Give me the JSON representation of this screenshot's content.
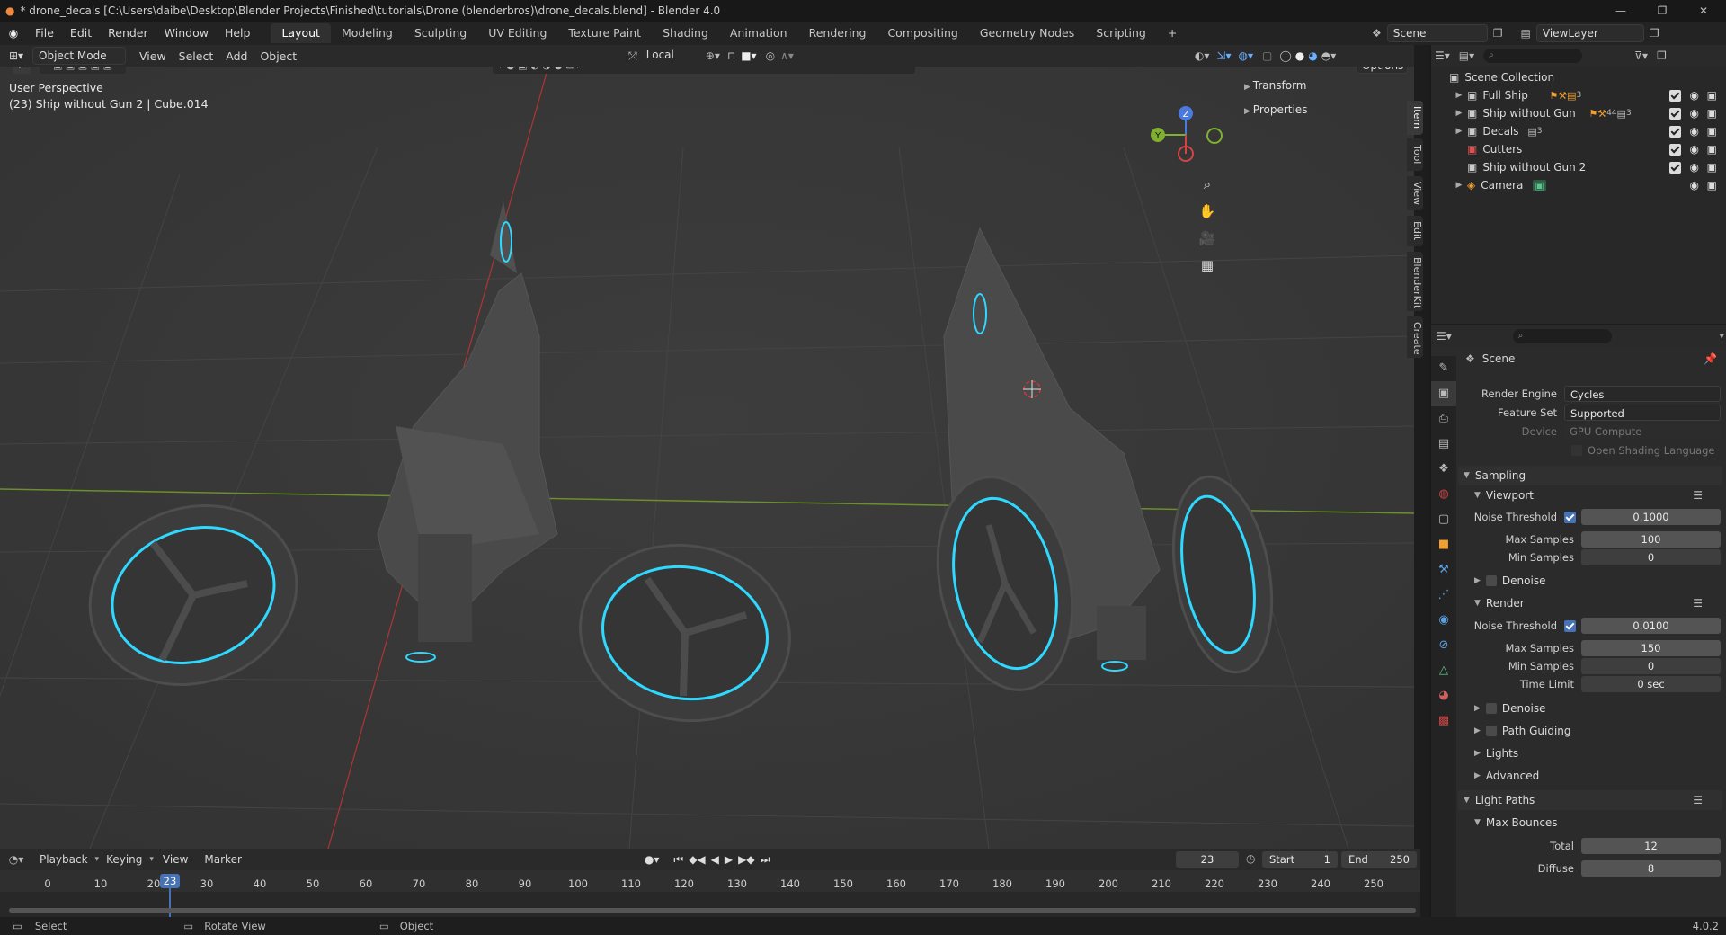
{
  "window": {
    "title": "* drone_decals [C:\\Users\\daibe\\Desktop\\Blender Projects\\Finished\\tutorials\\Drone (blenderbros)\\drone_decals.blend] - Blender 4.0"
  },
  "menu": [
    "File",
    "Edit",
    "Render",
    "Window",
    "Help"
  ],
  "workspaces": [
    "Layout",
    "Modeling",
    "Sculpting",
    "UV Editing",
    "Texture Paint",
    "Shading",
    "Animation",
    "Rendering",
    "Compositing",
    "Geometry Nodes",
    "Scripting"
  ],
  "active_workspace": "Layout",
  "scene_selector": "Scene",
  "viewlayer_selector": "ViewLayer",
  "viewport_header": {
    "mode": "Object Mode",
    "menus": [
      "View",
      "Select",
      "Add",
      "Object"
    ],
    "transform_orientation": "Local",
    "options_label": "Options"
  },
  "viewport": {
    "perspective": "User Perspective",
    "active_object": "(23) Ship without Gun 2 | Cube.014",
    "panels": [
      "Transform",
      "Properties"
    ],
    "side_tabs": [
      "Item",
      "Tool",
      "View",
      "Edit",
      "BlenderKit",
      "Create"
    ],
    "gizmo": {
      "z": "Z",
      "y": "Y"
    }
  },
  "outliner": {
    "root": "Scene Collection",
    "items": [
      {
        "name": "Full Ship",
        "badge": "3",
        "expand": true
      },
      {
        "name": "Ship without Gun",
        "badge": "3",
        "badge2": "44",
        "expand": true
      },
      {
        "name": "Decals",
        "badge": "3",
        "expand": true
      },
      {
        "name": "Cutters",
        "badge": "",
        "expand": false
      },
      {
        "name": "Ship without Gun 2",
        "badge": "",
        "expand": false
      },
      {
        "name": "Camera",
        "badge": "",
        "expand": true
      }
    ]
  },
  "properties": {
    "context": "Scene",
    "render_engine": {
      "label": "Render Engine",
      "value": "Cycles"
    },
    "feature_set": {
      "label": "Feature Set",
      "value": "Supported"
    },
    "device": {
      "label": "Device",
      "value": "GPU Compute"
    },
    "osl": "Open Shading Language",
    "sampling": "Sampling",
    "viewport": "Viewport",
    "viewport_noise_label": "Noise Threshold",
    "viewport_noise": "0.1000",
    "viewport_max_label": "Max Samples",
    "viewport_max": "100",
    "viewport_min_label": "Min Samples",
    "viewport_min": "0",
    "denoise": "Denoise",
    "render": "Render",
    "render_noise_label": "Noise Threshold",
    "render_noise": "0.0100",
    "render_max_label": "Max Samples",
    "render_max": "150",
    "render_min_label": "Min Samples",
    "render_min": "0",
    "time_limit_label": "Time Limit",
    "time_limit": "0 sec",
    "denoise2": "Denoise",
    "path_guiding": "Path Guiding",
    "lights": "Lights",
    "advanced": "Advanced",
    "light_paths": "Light Paths",
    "max_bounces": "Max Bounces",
    "total_label": "Total",
    "total": "12",
    "diffuse_label": "Diffuse",
    "diffuse": "8"
  },
  "timeline": {
    "menus": [
      "Playback",
      "Keying",
      "View",
      "Marker"
    ],
    "current_frame": "23",
    "start_label": "Start",
    "start": "1",
    "end_label": "End",
    "end": "250",
    "ruler": [
      "0",
      "10",
      "20",
      "30",
      "40",
      "50",
      "60",
      "70",
      "80",
      "90",
      "100",
      "110",
      "120",
      "130",
      "140",
      "150",
      "160",
      "170",
      "180",
      "190",
      "200",
      "210",
      "220",
      "230",
      "240",
      "250"
    ]
  },
  "statusbar": {
    "select": "Select",
    "rotate": "Rotate View",
    "object": "Object",
    "version": "4.0.2"
  },
  "colors": {
    "accent": "#4772b3",
    "neon": "#2fd8ff",
    "active_frame": "#4772b3"
  }
}
